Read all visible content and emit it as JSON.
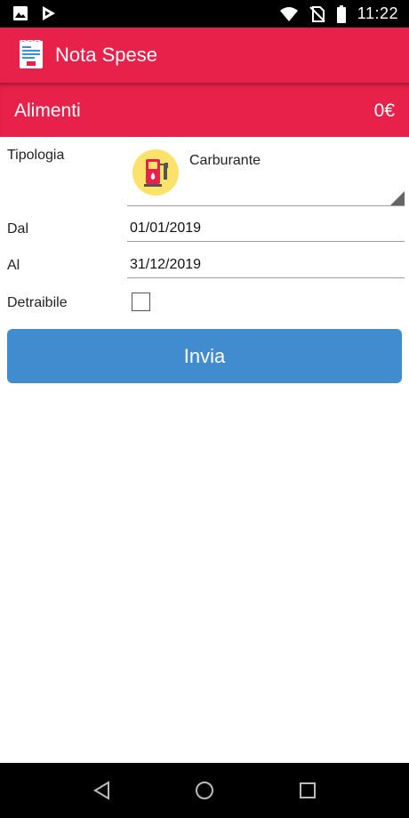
{
  "status_bar": {
    "time": "11:22",
    "icons": [
      "image-icon",
      "play-store-icon",
      "wifi-icon",
      "no-sim-icon",
      "battery-icon"
    ]
  },
  "app_bar": {
    "title": "Nota Spese",
    "logo_icon": "receipt-icon"
  },
  "category": {
    "name": "Alimenti",
    "total": "0€"
  },
  "form": {
    "type_label": "Tipologia",
    "type_value": "Carburante",
    "type_icon": "fuel-pump-icon",
    "from_label": "Dal",
    "from_value": "01/01/2019",
    "to_label": "Al",
    "to_value": "31/12/2019",
    "deductible_label": "Detraibile",
    "deductible_checked": false,
    "submit_label": "Invia"
  },
  "colors": {
    "accent": "#e8214a",
    "button": "#418bcf",
    "icon_bg": "#fbe26a"
  }
}
